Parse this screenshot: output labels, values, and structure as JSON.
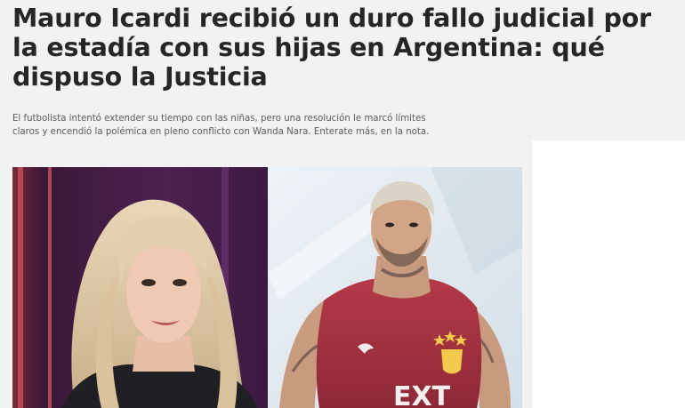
{
  "article": {
    "headline": "Mauro Icardi recibió un duro fallo judicial por la estadía con sus hijas en Argentina: qué dispuso la Justicia",
    "summary": "El futbolista intentó extender su tiempo con las niñas, pero una resolución le marcó límites claros y encendió la polémica en pleno conflicto con Wanda Nara. Enterate más, en la nota.",
    "photo": {
      "jersey_text": "EXT"
    }
  },
  "colors": {
    "page_background": "#f2f2f2",
    "headline": "#262626",
    "summary": "#5a5a5a",
    "left_photo_background": "#4a1f4a",
    "right_photo_background": "#dfe8f0",
    "jersey": "#a3303f"
  }
}
